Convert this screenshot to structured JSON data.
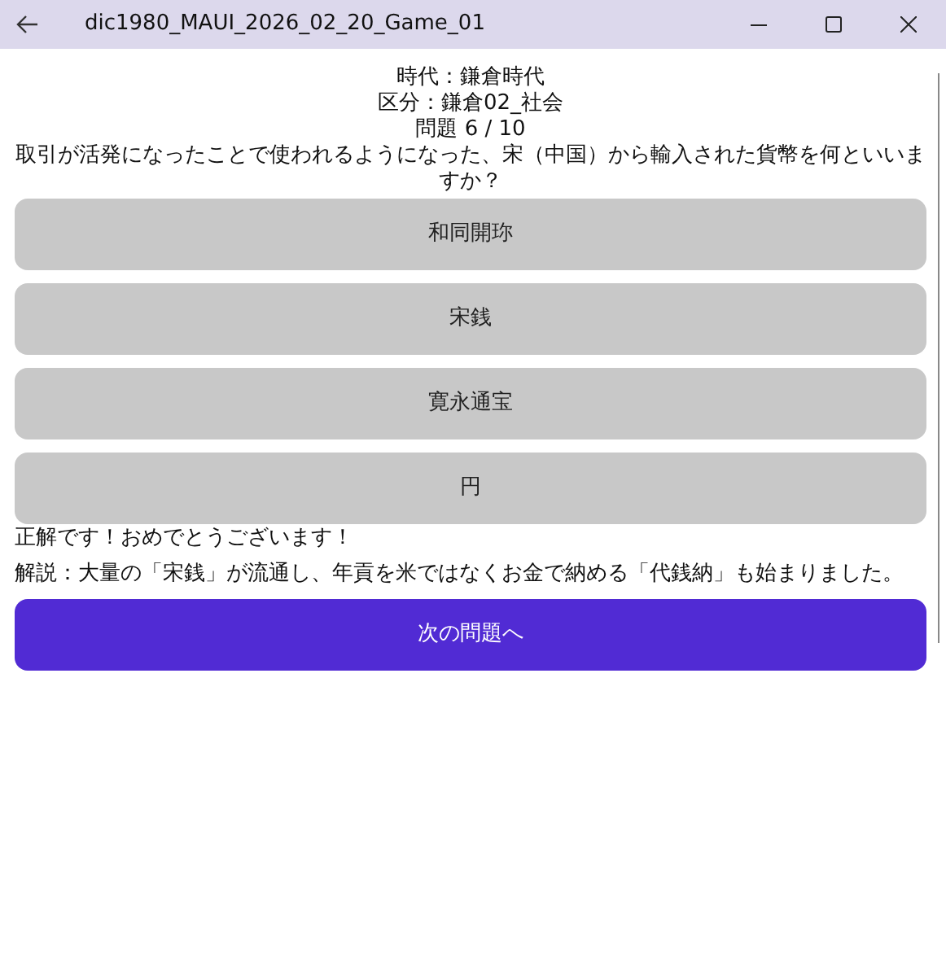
{
  "window": {
    "title": "dic1980_MAUI_2026_02_20_Game_01"
  },
  "header": [
    "時代：鎌倉時代",
    "区分：鎌倉02_社会",
    "問題 6 / 10"
  ],
  "question": "取引が活発になったことで使われるようになった、宋（中国）から輸入された貨幣を何といいますか？",
  "choices": [
    {
      "label": "和同開珎"
    },
    {
      "label": "宋銭"
    },
    {
      "label": "寛永通宝"
    },
    {
      "label": "円"
    }
  ],
  "result": "正解です！おめでとうございます！",
  "explanation": "解説：大量の「宋銭」が流通し、年貢を米ではなくお金で納める「代銭納」も始まりました。",
  "next_button": "次の問題へ"
}
